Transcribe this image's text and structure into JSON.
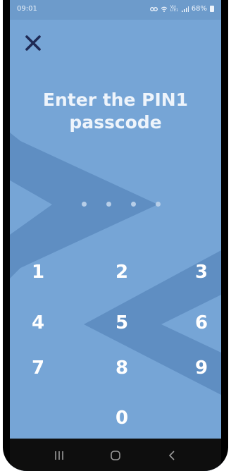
{
  "status_bar": {
    "time": "09:01",
    "network": "Vo) LTE1",
    "battery": "68%",
    "icons": [
      "link-icon",
      "wifi-icon",
      "signal-icon",
      "battery-icon"
    ]
  },
  "header": {
    "close_icon": "close-icon"
  },
  "title": {
    "line1": "Enter the PIN1",
    "line2": "passcode"
  },
  "pin": {
    "length": 4,
    "entered": 0
  },
  "keypad": {
    "keys": [
      "1",
      "2",
      "3",
      "4",
      "5",
      "6",
      "7",
      "8",
      "9",
      "0"
    ]
  },
  "nav_bar": {
    "buttons": [
      "recent-apps-icon",
      "home-icon",
      "back-icon"
    ]
  },
  "colors": {
    "background": "#76a5d6",
    "shape": "#5f8ec2",
    "text": "#ffffff",
    "close_icon": "#1f2a55"
  }
}
